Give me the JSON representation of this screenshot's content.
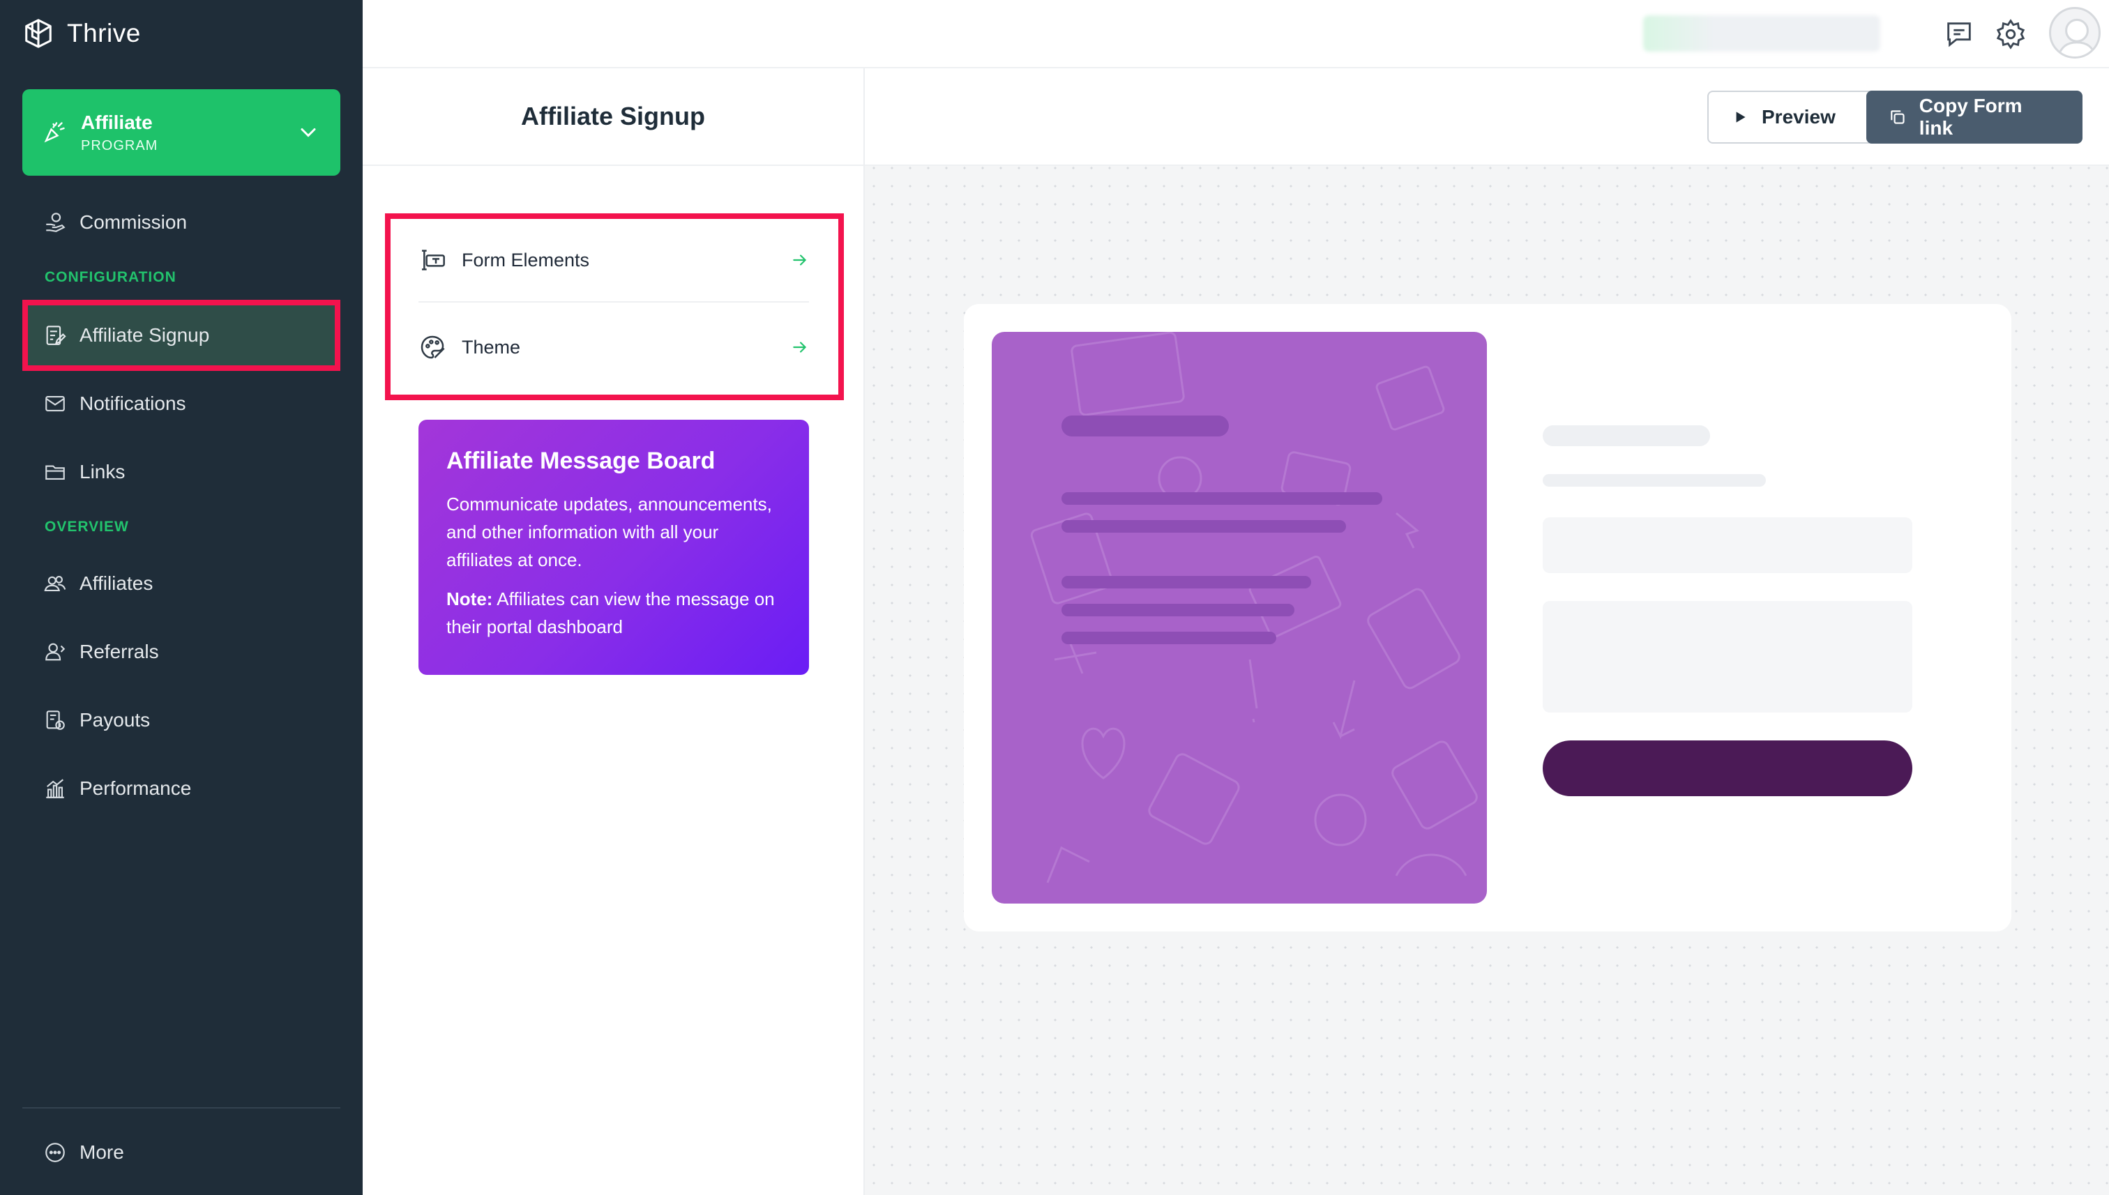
{
  "app": {
    "name": "Thrive"
  },
  "program": {
    "title": "Affiliate",
    "subtitle": "PROGRAM"
  },
  "sidebar": {
    "commission": "Commission",
    "config_label": "CONFIGURATION",
    "configuration": [
      {
        "label": "Affiliate Signup",
        "icon": "form-edit-icon",
        "active": true
      },
      {
        "label": "Notifications",
        "icon": "envelope-icon"
      },
      {
        "label": "Links",
        "icon": "folder-icon"
      }
    ],
    "overview_label": "OVERVIEW",
    "overview": [
      {
        "label": "Affiliates",
        "icon": "users-icon"
      },
      {
        "label": "Referrals",
        "icon": "referrals-icon"
      },
      {
        "label": "Payouts",
        "icon": "payouts-icon"
      },
      {
        "label": "Performance",
        "icon": "chart-icon"
      }
    ],
    "more": "More"
  },
  "page": {
    "title": "Affiliate Signup"
  },
  "toolbar": {
    "preview": "Preview",
    "copy_link": "Copy Form link"
  },
  "menu": [
    {
      "label": "Form Elements",
      "icon": "form-elements-icon"
    },
    {
      "label": "Theme",
      "icon": "palette-icon"
    }
  ],
  "message_board": {
    "title": "Affiliate Message Board",
    "body": "Communicate updates, announcements, and other information with all your affiliates at once.",
    "note_label": "Note:",
    "note_text": "Affiliates can view the message on their portal dashboard"
  },
  "colors": {
    "sidebar_bg": "#1f2d39",
    "accent_green": "#1ec26a",
    "highlight_red": "#f3134d",
    "board_purple": "#8a2ee8",
    "form_image": "#a862c9",
    "submit_button": "#4b1a56"
  }
}
